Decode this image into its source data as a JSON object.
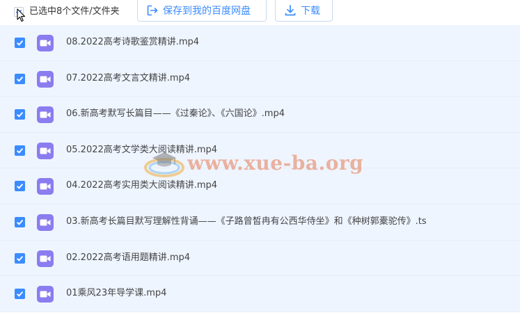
{
  "toolbar": {
    "select_all_label": "已选中8个文件/文件夹",
    "save_label": "保存到我的百度网盘",
    "download_label": "下载"
  },
  "files": [
    {
      "name": "08.2022高考诗歌鉴赏精讲.mp4",
      "checked": true
    },
    {
      "name": "07.2022高考文言文精讲.mp4",
      "checked": true
    },
    {
      "name": "06.新高考默写长篇目——《过秦论》、《六国论》.mp4",
      "checked": true
    },
    {
      "name": "05.2022高考文学类大阅读精讲.mp4",
      "checked": true
    },
    {
      "name": "04.2022高考实用类大阅读精讲.mp4",
      "checked": true
    },
    {
      "name": "03.新高考长篇目默写理解性背诵——《子路曾皙冉有公西华侍坐》和《种树郭橐驼传》.ts",
      "checked": true
    },
    {
      "name": "02.2022高考语用题精讲.mp4",
      "checked": true
    },
    {
      "name": "01乘风23年导学课.mp4",
      "checked": true
    }
  ],
  "watermark": {
    "text": "www.xue-ba.org"
  },
  "colors": {
    "accent": "#3b8cff",
    "row_selected": "#eef5ff",
    "video_icon": "#8b7cf0",
    "watermark": "#e87850"
  }
}
